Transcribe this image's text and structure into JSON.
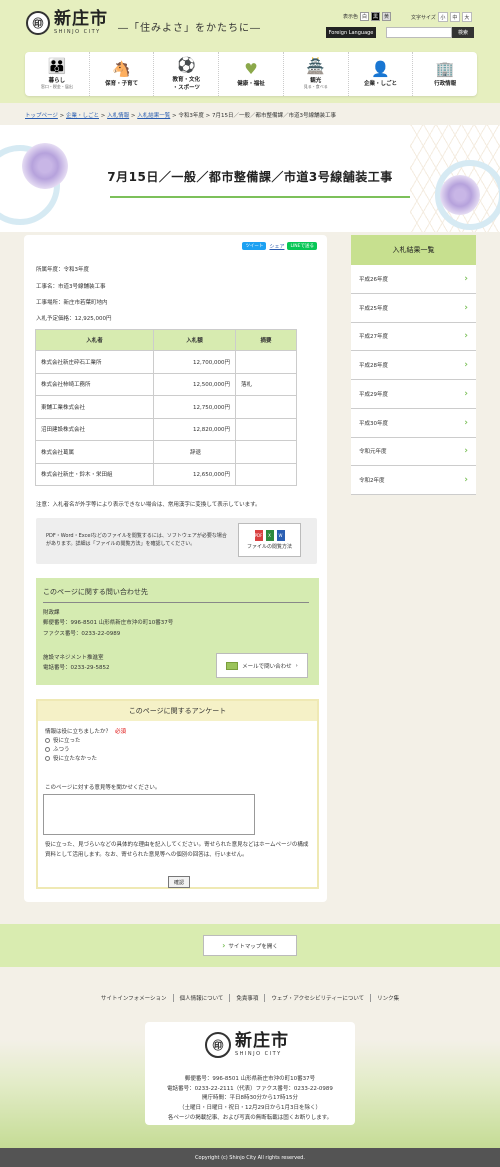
{
  "header": {
    "logo_mark": "㊞",
    "logo_ja": "新庄市",
    "logo_en": "SHINJO CITY",
    "slogan": "―「住みよさ」をかたちに―",
    "color_label": "表示色",
    "color_white": "白",
    "color_black": "黒",
    "color_gray": "黄",
    "fontsize_label": "文字サイズ",
    "font_small": "小",
    "font_mid": "中",
    "font_large": "大",
    "foreign": "Foreign Language",
    "search_placeholder": "",
    "search_button": "検索"
  },
  "gnav": [
    {
      "label": "暮らし",
      "sub": "窓口・税金・届出",
      "icon": "family-icon",
      "glyph": "👪"
    },
    {
      "label": "保育・子育て",
      "sub": "",
      "icon": "child-icon",
      "glyph": "🐴"
    },
    {
      "label": "教育・文化\n・スポーツ",
      "sub": "",
      "icon": "education-icon",
      "glyph": "⚽"
    },
    {
      "label": "健康・福祉",
      "sub": "",
      "icon": "health-icon",
      "glyph": "♥"
    },
    {
      "label": "観光",
      "sub": "見る・食べる",
      "icon": "tourism-icon",
      "glyph": "🏯"
    },
    {
      "label": "企業・しごと",
      "sub": "",
      "icon": "business-icon",
      "glyph": "👤"
    },
    {
      "label": "行政情報",
      "sub": "",
      "icon": "government-icon",
      "glyph": "🏢"
    }
  ],
  "breadcrumb": {
    "items": [
      "トップページ",
      "企業・しごと",
      "入札情報",
      "入札結果一覧"
    ],
    "rest": "令和3年度 > 7月15日／一般／都市整備課／市道3号線舗装工事",
    "sep": " > "
  },
  "page_title": "7月15日／一般／都市整備課／市道3号線舗装工事",
  "share": {
    "twitter": "ツイート",
    "share": "シェア",
    "line": "LINEで送る"
  },
  "info": {
    "year": "所属年度：令和3年度",
    "name": "工事名：市道3号線舗装工事",
    "place": "工事場所：新庄市若葉町地内",
    "price": "入札予定価格：12,925,000円"
  },
  "bid_table": {
    "headers": [
      "入札者",
      "入札額",
      "摘要"
    ],
    "rows": [
      [
        "株式会社新庄砕石工業所",
        "12,700,000円",
        ""
      ],
      [
        "株式会社柿崎工務所",
        "12,500,000円",
        "落札"
      ],
      [
        "東舗工業株式会社",
        "12,750,000円",
        ""
      ],
      [
        "沼田建設株式会社",
        "12,820,000円",
        ""
      ],
      [
        "株式会社葛属",
        "辞退",
        ""
      ],
      [
        "株式会社新庄・鈴木・栄田組",
        "12,650,000円",
        ""
      ]
    ]
  },
  "note": "注意：入札者名が外字等により表示できない場合は、常用漢字に変換して表示しています。",
  "pdf": {
    "text": "PDF・Word・Excelなどのファイルを閲覧するには、ソフトウェアが必要な場合があります。詳細は「ファイルの閲覧方法」を確認してください。",
    "button": "ファイルの閲覧方法",
    "doc1": "PDF",
    "doc2": "X",
    "doc3": "W"
  },
  "contact": {
    "title": "このページに関する問い合わせ先",
    "dept1": "財政課",
    "addr1": "郵便番号：996-8501 山形県新庄市沖の町10番37号",
    "fax1": "ファクス番号：0233-22-0989",
    "dept2": "施設マネジメント推進室",
    "tel2": "電話番号：0233-29-5852",
    "mail_button": "メールで問い合わせ"
  },
  "survey": {
    "title": "このページに関するアンケート",
    "q1": "情報は役に立ちましたか？",
    "required": "必須",
    "options": [
      "役に立った",
      "ふつう",
      "役に立たなかった"
    ],
    "q2": "このページに対する意見等を聞かせください。",
    "desc": "役に立った、見づらいなどの具体的な理由を記入してください。寄せられた意見などはホームページの構成資料として活用します。なお、寄せられた意見等への個別の回答は、行いません。",
    "submit": "確認"
  },
  "sidebar": {
    "title": "入札結果一覧",
    "items": [
      "平成26年度",
      "平成25年度",
      "平成27年度",
      "平成28年度",
      "平成29年度",
      "平成30年度",
      "令和元年度",
      "令和2年度"
    ]
  },
  "footer": {
    "sitemap": "サイトマップを開く",
    "links": [
      "サイトインフォメーション",
      "個人情報について",
      "免責事項",
      "ウェブ・アクセシビリティーについて",
      "リンク集"
    ],
    "addr": "郵便番号：996-8501 山形県新庄市沖の町10番37号",
    "tel": "電話番号：0233-22-2111（代表）ファクス番号：0233-22-0989",
    "hours": "開庁時間：平日8時30分から17時15分",
    "closed": "（土曜日・日曜日・祝日・12月29日から1月3日を除く）",
    "rights": "各ページの掲載記事、および写真の無断転載は固くお断りします。",
    "copyright": "Copyright (c) Shinjo City All rights reserved."
  }
}
